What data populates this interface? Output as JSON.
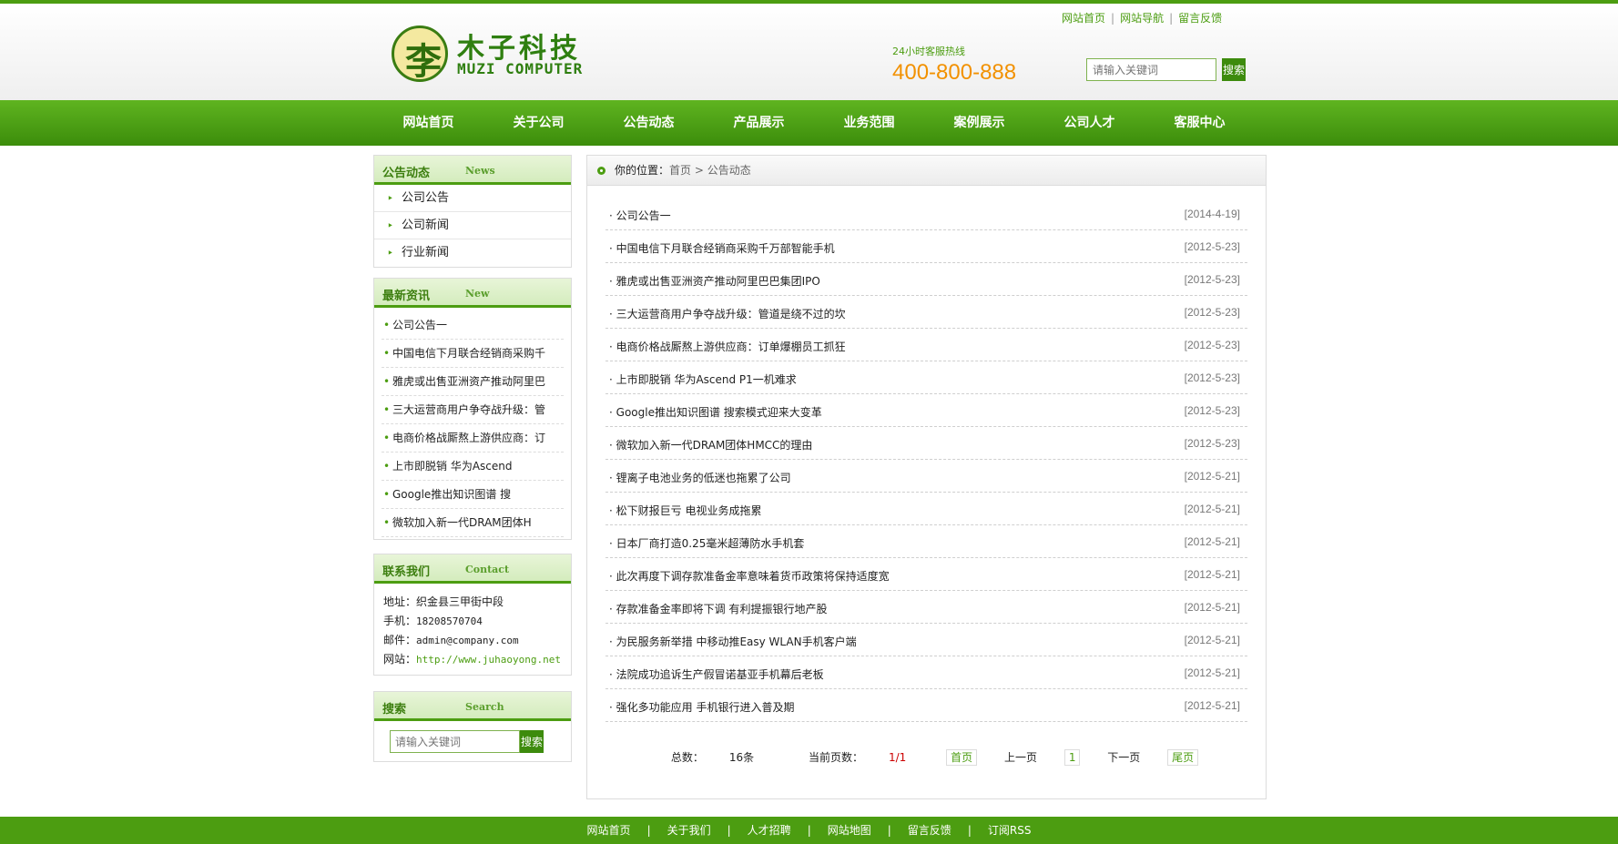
{
  "brand": {
    "mark": "李",
    "name_cn": "木子科技",
    "name_en": "MUZI COMPUTER"
  },
  "hotline": {
    "label": "24小时客服热线",
    "number": "400-800-888"
  },
  "top_links": [
    "网站首页",
    "网站导航",
    "留言反馈"
  ],
  "top_search": {
    "placeholder": "请输入关键词",
    "button": "搜索"
  },
  "nav": [
    "网站首页",
    "关于公司",
    "公告动态",
    "产品展示",
    "业务范围",
    "案例展示",
    "公司人才",
    "客服中心"
  ],
  "sidebar": {
    "categories": {
      "title_cn": "公告动态",
      "title_en": "News",
      "items": [
        "公司公告",
        "公司新闻",
        "行业新闻"
      ]
    },
    "latest": {
      "title_cn": "最新资讯",
      "title_en": "New",
      "items": [
        "公司公告一",
        "中国电信下月联合经销商采购千",
        "雅虎或出售亚洲资产推动阿里巴",
        "三大运营商用户争夺战升级：管",
        "电商价格战厮熬上游供应商：订",
        "上市即脱销 华为Ascend",
        "Google推出知识图谱 搜",
        "微软加入新一代DRAM团体H"
      ]
    },
    "contact": {
      "title_cn": "联系我们",
      "title_en": "Contact",
      "address_label": "地址：",
      "address": "织金县三甲街中段",
      "phone_label": "手机：",
      "phone": "18208570704",
      "email_label": "邮件：",
      "email": "admin@company.com",
      "site_label": "网站：",
      "site": "http://www.juhaoyong.net"
    },
    "search": {
      "title_cn": "搜索",
      "title_en": "Search",
      "placeholder": "请输入关键词",
      "button": "搜索"
    }
  },
  "breadcrumb": {
    "label": "你的位置：",
    "home": "首页",
    "separator": ">",
    "current": "公告动态"
  },
  "articles": [
    {
      "title": "公司公告一",
      "date": "[2014-4-19]"
    },
    {
      "title": "中国电信下月联合经销商采购千万部智能手机",
      "date": "[2012-5-23]"
    },
    {
      "title": "雅虎或出售亚洲资产推动阿里巴巴集团IPO",
      "date": "[2012-5-23]"
    },
    {
      "title": "三大运营商用户争夺战升级：管道是绕不过的坎",
      "date": "[2012-5-23]"
    },
    {
      "title": "电商价格战厮熬上游供应商：订单爆棚员工抓狂",
      "date": "[2012-5-23]"
    },
    {
      "title": "上市即脱销 华为Ascend P1一机难求",
      "date": "[2012-5-23]"
    },
    {
      "title": "Google推出知识图谱 搜索模式迎来大变革",
      "date": "[2012-5-23]"
    },
    {
      "title": "微软加入新一代DRAM团体HMCC的理由",
      "date": "[2012-5-23]"
    },
    {
      "title": "锂离子电池业务的低迷也拖累了公司",
      "date": "[2012-5-21]"
    },
    {
      "title": "松下财报巨亏 电视业务成拖累",
      "date": "[2012-5-21]"
    },
    {
      "title": "日本厂商打造0.25毫米超薄防水手机套",
      "date": "[2012-5-21]"
    },
    {
      "title": "此次再度下调存款准备金率意味着货币政策将保持适度宽",
      "date": "[2012-5-21]"
    },
    {
      "title": "存款准备金率即将下调 有利提振银行地产股",
      "date": "[2012-5-21]"
    },
    {
      "title": "为民服务新举措 中移动推Easy WLAN手机客户端",
      "date": "[2012-5-21]"
    },
    {
      "title": "法院成功追诉生产假冒诺基亚手机幕后老板",
      "date": "[2012-5-21]"
    },
    {
      "title": "强化多功能应用 手机银行进入普及期",
      "date": "[2012-5-21]"
    }
  ],
  "pager": {
    "total_label": "总数：",
    "total": "16条",
    "page_label": "当前页数：",
    "page": "1/1",
    "first": "首页",
    "prev": "上一页",
    "current": "1",
    "next": "下一页",
    "last": "尾页"
  },
  "footer_links": [
    "网站首页",
    "关于我们",
    "人才招聘",
    "网站地图",
    "留言反馈",
    "订阅RSS"
  ],
  "colors": {
    "brand_green": "#4c9d11",
    "hotline_orange": "#f29100"
  }
}
